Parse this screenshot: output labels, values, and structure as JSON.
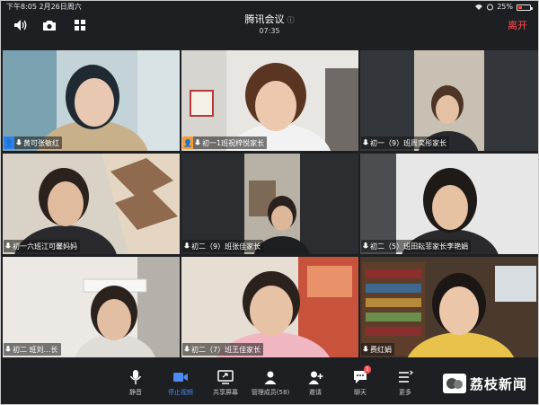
{
  "status_bar": {
    "time": "下午8:05  2月26日周六",
    "battery": "25%"
  },
  "meeting": {
    "title": "腾讯会议",
    "timer": "07:35",
    "leave_label": "离开"
  },
  "participants": [
    {
      "name": "黄可张敏红",
      "host": "blue"
    },
    {
      "name": "初一1班祝梓悦家长",
      "host": "orange"
    },
    {
      "name": "初一（9）班周奕彤家长",
      "host": ""
    },
    {
      "name": "初一六班江可馨妈妈",
      "host": ""
    },
    {
      "name": "初二（9）班张佳家长",
      "host": ""
    },
    {
      "name": "初二（5）班田耘菲家长李艳娟",
      "host": ""
    },
    {
      "name": "初二  班刘…长",
      "host": ""
    },
    {
      "name": "初二（7）班王佳家长",
      "host": ""
    },
    {
      "name": "费红娟",
      "host": ""
    }
  ],
  "toolbar": [
    {
      "label": "静音",
      "icon": "mic-icon"
    },
    {
      "label": "停止视频",
      "icon": "video-icon"
    },
    {
      "label": "共享屏幕",
      "icon": "share-screen-icon"
    },
    {
      "label": "管理成员(58)",
      "icon": "members-icon"
    },
    {
      "label": "邀请",
      "icon": "invite-icon"
    },
    {
      "label": "聊天",
      "icon": "chat-icon",
      "badge": "1"
    },
    {
      "label": "更多",
      "icon": "more-icon"
    }
  ],
  "watermark": {
    "logo": "荔枝",
    "text": "荔枝新闻"
  }
}
